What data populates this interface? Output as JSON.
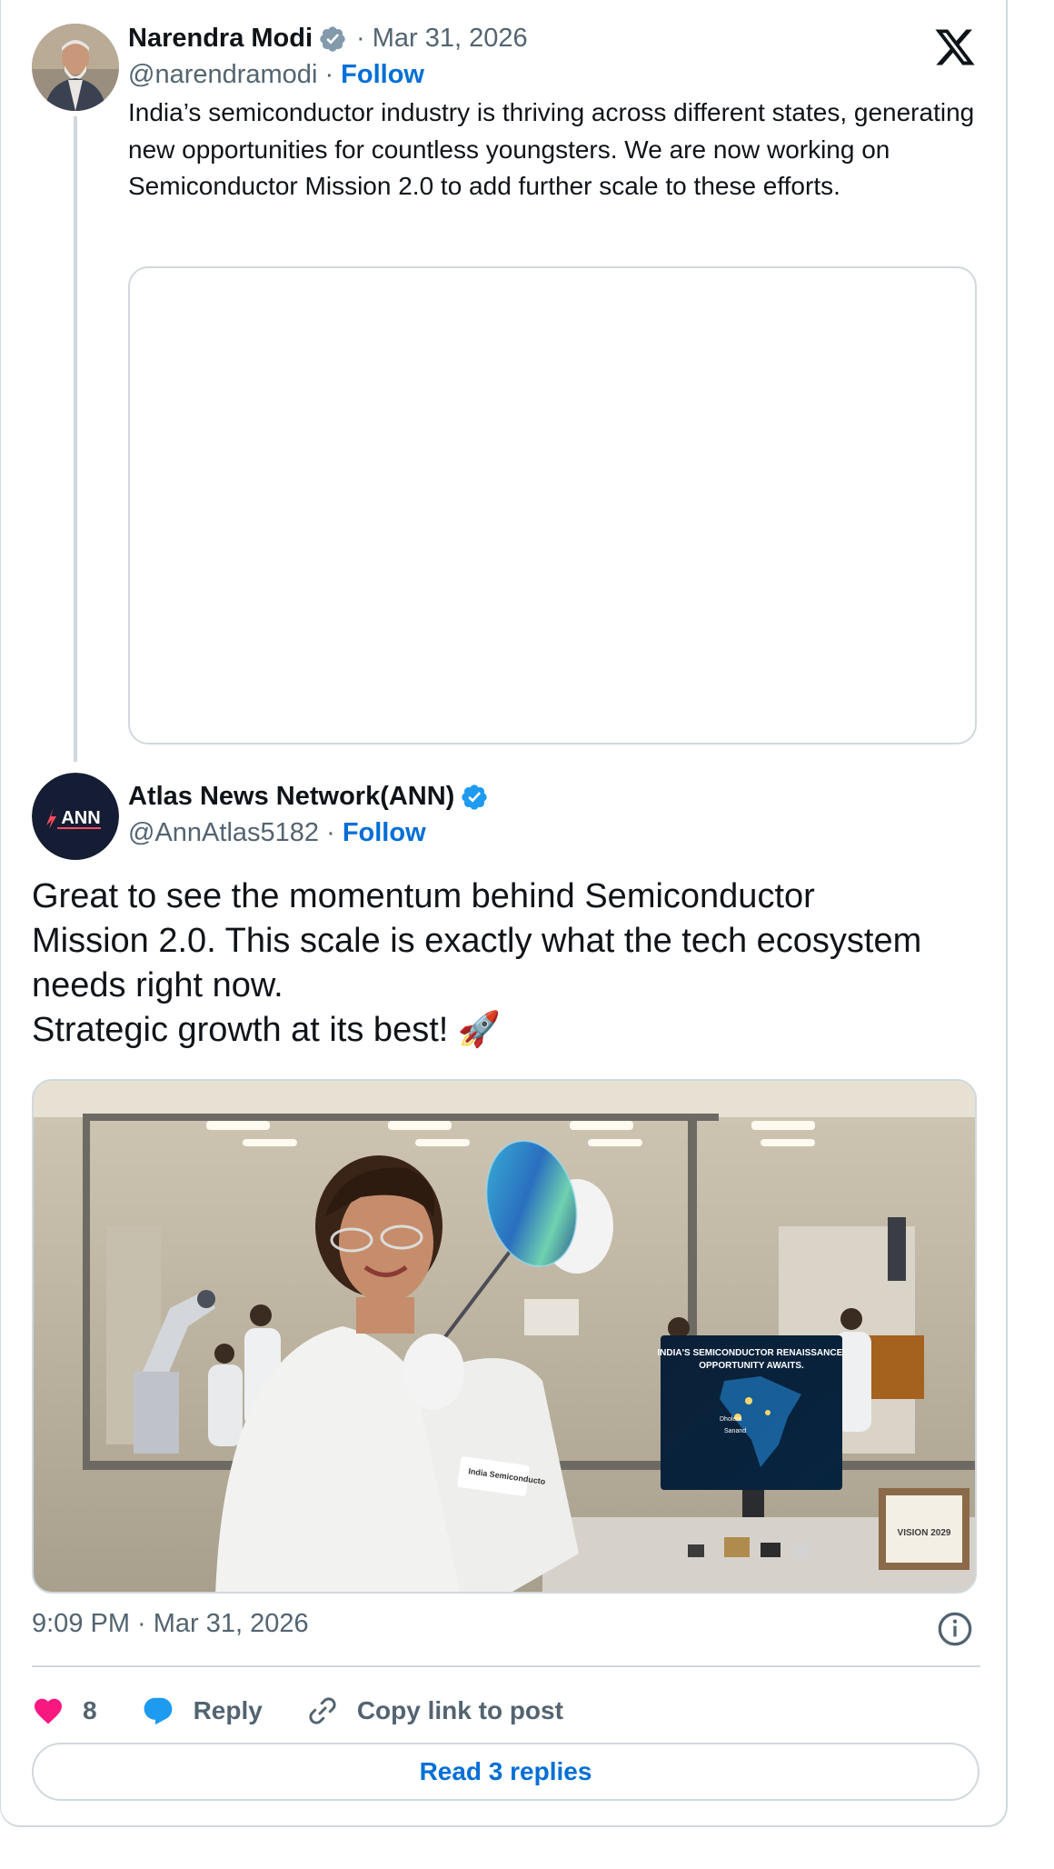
{
  "quoted_post": {
    "author_name": "Narendra Modi",
    "date": "Mar 31, 2026",
    "handle": "@narendramodi",
    "follow_label": "Follow",
    "text": "India’s semiconductor industry is thriving across different states, generating new opportunities for countless youngsters. We are now working on Semiconductor Mission 2.0 to add further scale to these efforts.",
    "verified_badge_color": "#829aab"
  },
  "post": {
    "author_name": "Atlas News Network(ANN)",
    "avatar_text": "ANN",
    "handle": "@AnnAtlas5182",
    "follow_label": "Follow",
    "text_lines": [
      "Great to see the momentum behind Semiconductor",
      "Mission 2.0. This scale is exactly what the tech ecosystem",
      "needs right now.",
      "Strategic growth at its best! 🚀"
    ],
    "verified_badge_color": "#1d9bf0",
    "image": {
      "screen_title": "INDIA'S SEMICONDUCTOR RENAISSANCE: OPPORTUNITY AWAITS.",
      "badge_text": "India Semiconducto",
      "plaque_text": "VISION 2029",
      "map_labels": [
        "Dholera",
        "Sanand"
      ]
    },
    "timestamp": "9:09 PM · Mar 31, 2026"
  },
  "actions": {
    "like_count": "8",
    "reply_label": "Reply",
    "copy_link_label": "Copy link to post",
    "like_color": "#f91880",
    "reply_color": "#1d9bf0"
  },
  "read_replies_label": "Read 3 replies",
  "icons": [
    "x-logo-icon",
    "verified-icon",
    "heart-icon",
    "reply-bubble-icon",
    "link-icon",
    "info-icon"
  ]
}
